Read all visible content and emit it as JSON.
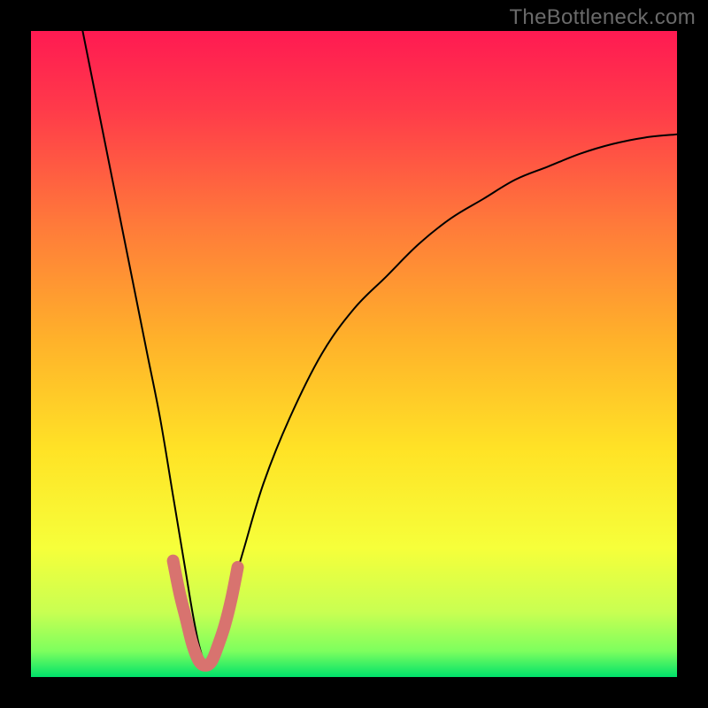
{
  "watermark": "TheBottleneck.com",
  "colors": {
    "frame": "#000000",
    "gradient_top": "#ff1a52",
    "gradient_mid": "#fff22a",
    "gradient_low": "#b6ff4a",
    "gradient_bottom": "#00e26a",
    "curve": "#000000",
    "accent_marker": "#d8736f",
    "watermark": "#6a6a6a"
  },
  "chart_data": {
    "type": "line",
    "title": "",
    "xlabel": "",
    "ylabel": "",
    "xlim": [
      0,
      100
    ],
    "ylim": [
      0,
      100
    ],
    "dip_x": 27,
    "dip_radius": 5,
    "series": [
      {
        "name": "bottleneck-curve",
        "x": [
          8,
          10,
          12,
          14,
          16,
          18,
          20,
          22,
          23,
          24,
          25,
          26,
          27,
          28,
          29,
          30,
          31,
          33,
          36,
          40,
          45,
          50,
          55,
          60,
          65,
          70,
          75,
          80,
          85,
          90,
          95,
          100
        ],
        "y": [
          100,
          90,
          80,
          70,
          60,
          50,
          40,
          28,
          22,
          16,
          10,
          5,
          2,
          2,
          5,
          9,
          13,
          20,
          30,
          40,
          50,
          57,
          62,
          67,
          71,
          74,
          77,
          79,
          81,
          82.5,
          83.5,
          84
        ]
      }
    ],
    "accent_segment": {
      "x": [
        22,
        23,
        24,
        25,
        26,
        27,
        28,
        29,
        30,
        31,
        32
      ],
      "y": [
        18,
        13,
        9,
        5,
        2.5,
        1.8,
        2.5,
        5,
        8,
        12,
        17
      ]
    }
  }
}
